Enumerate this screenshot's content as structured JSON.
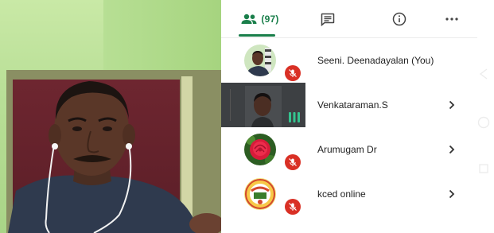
{
  "tabs": {
    "people_count": "(97)",
    "people_icon": "people-icon",
    "chat_icon": "chat-icon",
    "info_icon": "info-icon",
    "more_icon": "more-icon"
  },
  "accent_color": "#1a7f4b",
  "mute_color": "#d93025",
  "participants": [
    {
      "name": "Seeni. Deenadayalan (You)",
      "muted": true,
      "show_chevron": false
    },
    {
      "name": "Venkataraman.S",
      "muted": false,
      "speaking": true,
      "show_chevron": true
    },
    {
      "name": "Arumugam Dr",
      "muted": true,
      "show_chevron": true
    },
    {
      "name": "kced online",
      "muted": true,
      "show_chevron": true
    }
  ]
}
